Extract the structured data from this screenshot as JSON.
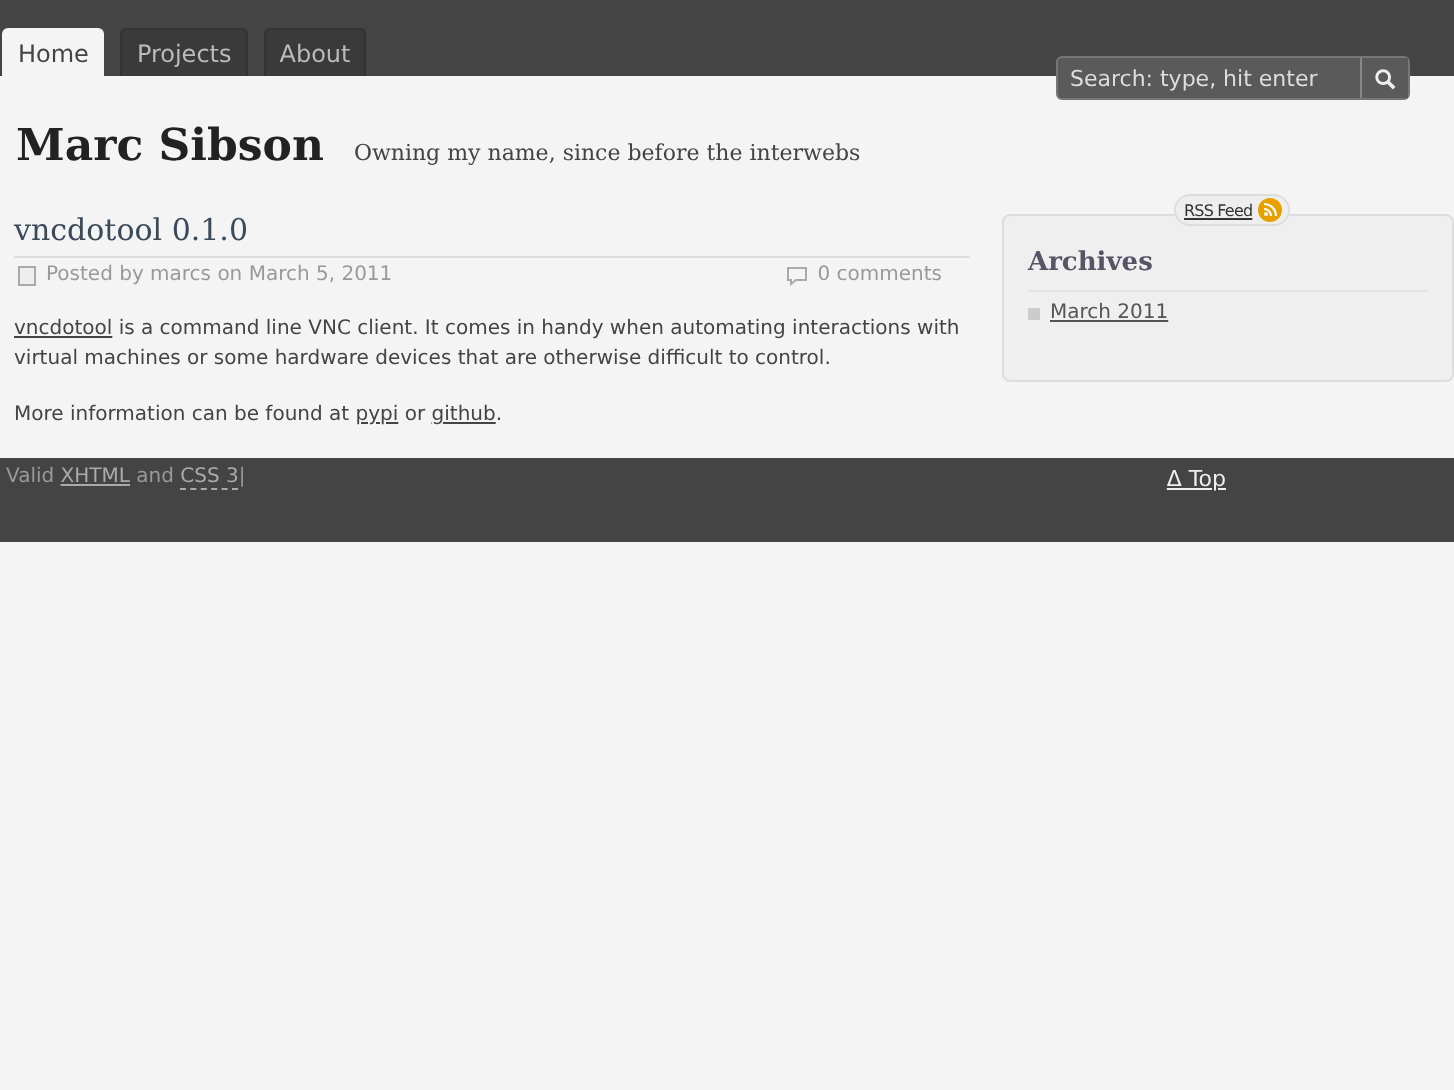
{
  "nav": {
    "tabs": [
      {
        "label": "Home",
        "selected": true
      },
      {
        "label": "Projects",
        "selected": false
      },
      {
        "label": "About",
        "selected": false
      }
    ],
    "search": {
      "placeholder": "Search: type, hit enter"
    }
  },
  "site": {
    "title": "Marc Sibson",
    "tagline": "Owning my name, since before the interwebs"
  },
  "post": {
    "title": "vncdotool 0.1.0",
    "meta": "Posted by marcs on March 5, 2011",
    "comments": "0 comments",
    "paragraphs": [
      [
        {
          "kind": "link",
          "text": "vncdotool"
        },
        {
          "kind": "text",
          "text": " is a command line VNC client. It comes in handy when automating interactions with virtual machines or some hardware devices that are otherwise difficult to control."
        }
      ],
      [
        {
          "kind": "text",
          "text": "More information can be found at "
        },
        {
          "kind": "link",
          "text": "pypi"
        },
        {
          "kind": "text",
          "text": " or "
        },
        {
          "kind": "link",
          "text": "github"
        },
        {
          "kind": "text",
          "text": "."
        }
      ]
    ]
  },
  "sidebar": {
    "rss": "RSS Feed",
    "widgets": [
      {
        "title": "Archives",
        "items": [
          "March 2011"
        ]
      }
    ]
  },
  "footer": {
    "credits": [
      {
        "kind": "text",
        "text": "Valid "
      },
      {
        "kind": "link",
        "text": "XHTML"
      },
      {
        "kind": "text",
        "text": " and "
      },
      {
        "kind": "abbr",
        "text": "CSS 3"
      },
      {
        "kind": "text",
        "text": "|"
      }
    ],
    "top_link": "Δ Top"
  }
}
